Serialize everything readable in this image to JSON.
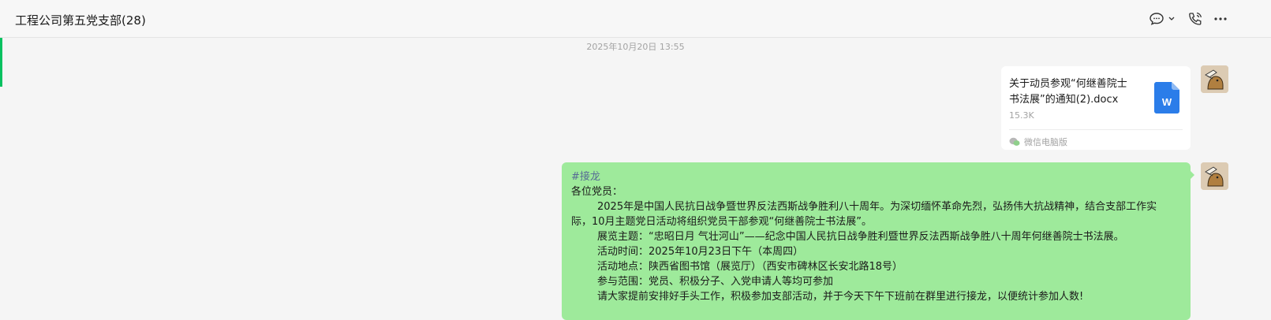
{
  "header": {
    "title": "工程公司第五党支部(28)"
  },
  "icons": {
    "chat": "chat-bubble-icon",
    "dropdown": "chevron-down-icon",
    "call": "phone-call-icon",
    "more": "more-dots-icon"
  },
  "timestamp": "2025年10月20日 13:55",
  "file_message": {
    "name_line1": "关于动员参观“何继善院士",
    "name_line2": "书法展”的通知(2).docx",
    "size": "15.3K",
    "source": "微信电脑版",
    "icon_letter": "W"
  },
  "text_message": {
    "tag": "#接龙",
    "lines": [
      "各位党员：",
      "2025年是中国人民抗日战争暨世界反法西斯战争胜利八十周年。为深切缅怀革命先烈，弘扬伟大抗战精神，结合支部工作实",
      "际，10月主题党日活动将组织党员干部参观“何继善院士书法展”。",
      "展览主题：“忠昭日月 气壮河山”——纪念中国人民抗日战争胜利暨世界反法西斯战争胜八十周年何继善院士书法展。",
      "活动时间：2025年10月23日下午（本周四）",
      "活动地点：陕西省图书馆（展览厅）（西安市碑林区长安北路18号）",
      "参与范围：党员、积极分子、入党申请人等均可参加",
      "请大家提前安排好手头工作，积极参加支部活动，并于今天下午下班前在群里进行接龙，以便统计参加人数!"
    ]
  },
  "colors": {
    "accent": "#07c160",
    "bubble_green": "#9eea9b",
    "doc_blue": "#2b7de9"
  }
}
